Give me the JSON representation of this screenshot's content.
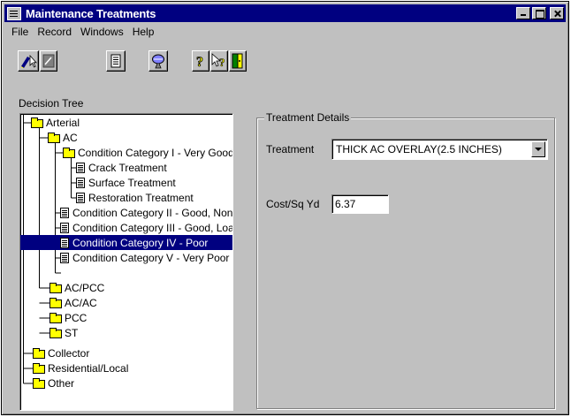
{
  "window": {
    "title": "Maintenance Treatments"
  },
  "menu": [
    "File",
    "Record",
    "Windows",
    "Help"
  ],
  "toolbar": [
    {
      "icon": "pencil-select-icon"
    },
    {
      "icon": "form-icon"
    },
    {
      "icon": "document-icon"
    },
    {
      "icon": "magnifier-icon"
    },
    {
      "icon": "help-icon"
    },
    {
      "icon": "context-help-icon"
    },
    {
      "icon": "exit-door-icon"
    }
  ],
  "decision_tree": {
    "label": "Decision Tree",
    "nodes": [
      {
        "text": "Arterial",
        "icon": "folder-open"
      },
      {
        "text": "AC",
        "icon": "folder-open"
      },
      {
        "text": "Condition Category I - Very Good",
        "icon": "folder-open"
      },
      {
        "text": "Crack Treatment",
        "icon": "document"
      },
      {
        "text": "Surface Treatment",
        "icon": "document"
      },
      {
        "text": "Restoration Treatment",
        "icon": "document"
      },
      {
        "text": "Condition Category II - Good, Non-Load",
        "icon": "document"
      },
      {
        "text": "Condition Category III - Good, Load Re",
        "icon": "document"
      },
      {
        "text": "Condition Category IV - Poor",
        "icon": "document",
        "selected": true
      },
      {
        "text": "Condition Category V - Very Poor",
        "icon": "document"
      },
      {
        "text": "AC/PCC",
        "icon": "folder"
      },
      {
        "text": "AC/AC",
        "icon": "folder"
      },
      {
        "text": "PCC",
        "icon": "folder"
      },
      {
        "text": "ST",
        "icon": "folder"
      },
      {
        "text": "Collector",
        "icon": "folder"
      },
      {
        "text": "Residential/Local",
        "icon": "folder"
      },
      {
        "text": "Other",
        "icon": "folder"
      }
    ]
  },
  "treatment_details": {
    "title": "Treatment Details",
    "treatment_label": "Treatment",
    "treatment_value": "THICK AC OVERLAY(2.5 INCHES)",
    "cost_label": "Cost/Sq Yd",
    "cost_value": "6.37"
  },
  "colors": {
    "selection": "#000080",
    "face": "#c0c0c0",
    "folder": "#ffff00"
  }
}
